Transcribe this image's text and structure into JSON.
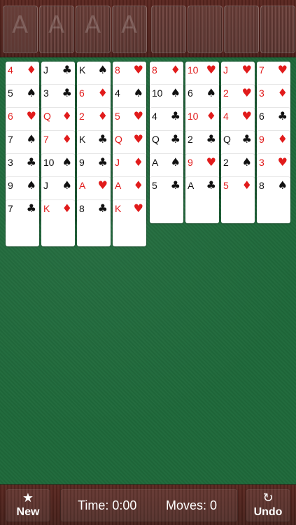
{
  "top_bar": {
    "foundation_slots": [
      {
        "mark": "A"
      },
      {
        "mark": "A"
      },
      {
        "mark": "A"
      },
      {
        "mark": "A"
      }
    ],
    "free_cells": [
      {
        "mark": ""
      },
      {
        "mark": ""
      },
      {
        "mark": ""
      },
      {
        "mark": ""
      }
    ]
  },
  "tableau": [
    [
      {
        "rank": "4",
        "suit": "♦",
        "color": "red"
      },
      {
        "rank": "5",
        "suit": "♠",
        "color": "black"
      },
      {
        "rank": "6",
        "suit": "♥",
        "color": "red"
      },
      {
        "rank": "7",
        "suit": "♠",
        "color": "black"
      },
      {
        "rank": "3",
        "suit": "♣",
        "color": "black"
      },
      {
        "rank": "9",
        "suit": "♠",
        "color": "black"
      },
      {
        "rank": "7",
        "suit": "♣",
        "color": "black"
      }
    ],
    [
      {
        "rank": "J",
        "suit": "♣",
        "color": "black"
      },
      {
        "rank": "3",
        "suit": "♣",
        "color": "black"
      },
      {
        "rank": "Q",
        "suit": "♦",
        "color": "red"
      },
      {
        "rank": "7",
        "suit": "♦",
        "color": "red"
      },
      {
        "rank": "10",
        "suit": "♠",
        "color": "black"
      },
      {
        "rank": "J",
        "suit": "♠",
        "color": "black"
      },
      {
        "rank": "K",
        "suit": "♦",
        "color": "red"
      }
    ],
    [
      {
        "rank": "K",
        "suit": "♠",
        "color": "black"
      },
      {
        "rank": "6",
        "suit": "♦",
        "color": "red"
      },
      {
        "rank": "2",
        "suit": "♦",
        "color": "red"
      },
      {
        "rank": "K",
        "suit": "♣",
        "color": "black"
      },
      {
        "rank": "9",
        "suit": "♣",
        "color": "black"
      },
      {
        "rank": "A",
        "suit": "♥",
        "color": "red"
      },
      {
        "rank": "8",
        "suit": "♣",
        "color": "black"
      }
    ],
    [
      {
        "rank": "8",
        "suit": "♥",
        "color": "red"
      },
      {
        "rank": "4",
        "suit": "♠",
        "color": "black"
      },
      {
        "rank": "5",
        "suit": "♥",
        "color": "red"
      },
      {
        "rank": "Q",
        "suit": "♥",
        "color": "red"
      },
      {
        "rank": "J",
        "suit": "♦",
        "color": "red"
      },
      {
        "rank": "A",
        "suit": "♦",
        "color": "red"
      },
      {
        "rank": "K",
        "suit": "♥",
        "color": "red"
      }
    ],
    [
      {
        "rank": "8",
        "suit": "♦",
        "color": "red"
      },
      {
        "rank": "10",
        "suit": "♠",
        "color": "black"
      },
      {
        "rank": "4",
        "suit": "♣",
        "color": "black"
      },
      {
        "rank": "Q",
        "suit": "♣",
        "color": "black"
      },
      {
        "rank": "A",
        "suit": "♠",
        "color": "black"
      },
      {
        "rank": "5",
        "suit": "♣",
        "color": "black"
      }
    ],
    [
      {
        "rank": "10",
        "suit": "♥",
        "color": "red"
      },
      {
        "rank": "6",
        "suit": "♠",
        "color": "black"
      },
      {
        "rank": "10",
        "suit": "♦",
        "color": "red"
      },
      {
        "rank": "2",
        "suit": "♣",
        "color": "black"
      },
      {
        "rank": "9",
        "suit": "♥",
        "color": "red"
      },
      {
        "rank": "A",
        "suit": "♣",
        "color": "black"
      }
    ],
    [
      {
        "rank": "J",
        "suit": "♥",
        "color": "red"
      },
      {
        "rank": "2",
        "suit": "♥",
        "color": "red"
      },
      {
        "rank": "4",
        "suit": "♥",
        "color": "red"
      },
      {
        "rank": "Q",
        "suit": "♣",
        "color": "black"
      },
      {
        "rank": "2",
        "suit": "♠",
        "color": "black"
      },
      {
        "rank": "5",
        "suit": "♦",
        "color": "red"
      }
    ],
    [
      {
        "rank": "7",
        "suit": "♥",
        "color": "red"
      },
      {
        "rank": "3",
        "suit": "♦",
        "color": "red"
      },
      {
        "rank": "6",
        "suit": "♣",
        "color": "black"
      },
      {
        "rank": "9",
        "suit": "♦",
        "color": "red"
      },
      {
        "rank": "3",
        "suit": "♥",
        "color": "red"
      },
      {
        "rank": "8",
        "suit": "♠",
        "color": "black"
      }
    ]
  ],
  "bottom_bar": {
    "new_button": {
      "icon": "★",
      "label": "New"
    },
    "status": {
      "time_text": "Time: 0:00",
      "moves_text": "Moves: 0"
    },
    "undo_button": {
      "icon": "↻",
      "label": "Undo"
    }
  },
  "colors": {
    "felt": "#1f6a3b",
    "wood": "#4a1f1a",
    "red_suit": "#e11b1b",
    "black_suit": "#111111"
  }
}
